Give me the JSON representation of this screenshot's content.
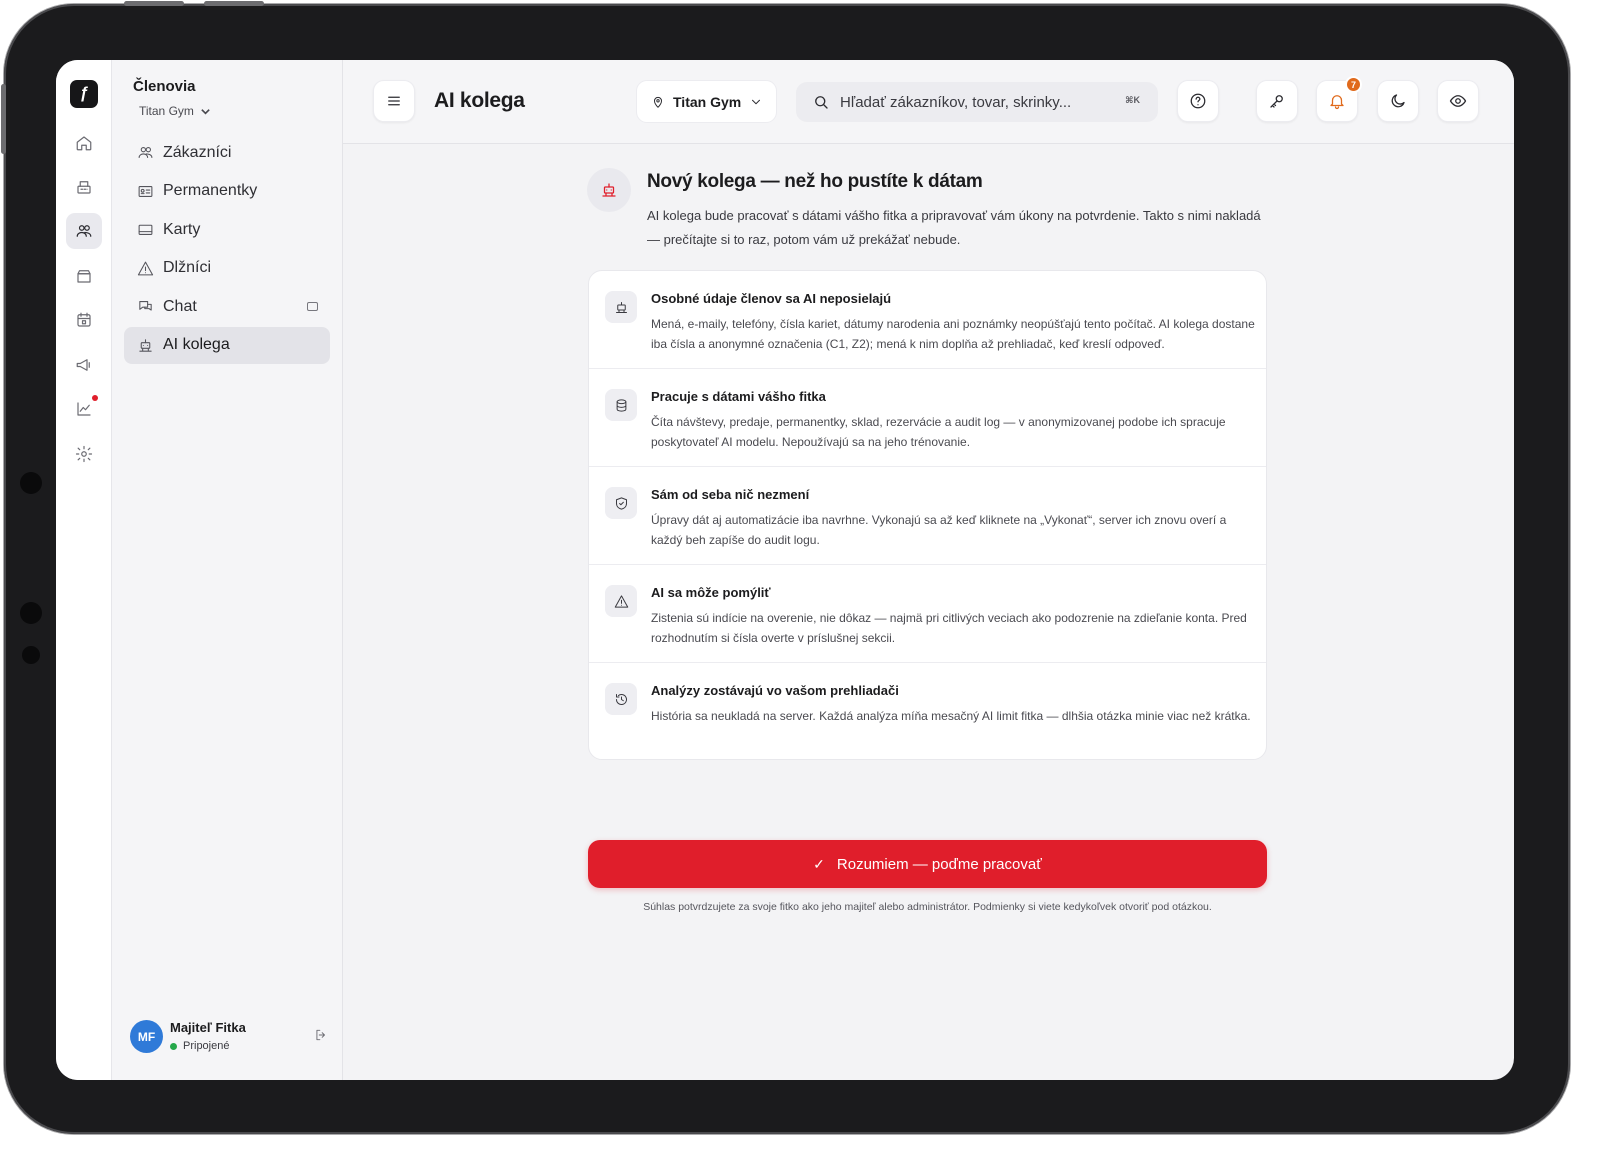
{
  "sidebar": {
    "title": "Členovia",
    "gym": "Titan Gym",
    "items": [
      {
        "label": "Zákazníci",
        "icon": "users-icon"
      },
      {
        "label": "Permanentky",
        "icon": "id-card-icon"
      },
      {
        "label": "Karty",
        "icon": "card-icon"
      },
      {
        "label": "Dlžníci",
        "icon": "warning-icon"
      },
      {
        "label": "Chat",
        "icon": "chat-icon"
      },
      {
        "label": "AI kolega",
        "icon": "robot-icon",
        "active": true
      }
    ],
    "user": {
      "initials": "MF",
      "name": "Majiteľ Fitka",
      "status": "Pripojené"
    }
  },
  "rail": {
    "items": [
      "home-icon",
      "register-icon",
      "members-icon",
      "store-icon",
      "calendar-icon",
      "megaphone-icon",
      "chart-icon",
      "settings-icon"
    ],
    "active": "members-icon"
  },
  "header": {
    "title": "AI kolega",
    "location": "Titan Gym",
    "search_placeholder": "Hľadať zákazníkov, tovar, skrinky...",
    "search_shortcut": "⌘K",
    "notifications_count": "7"
  },
  "intro": {
    "title": "Nový kolega — než ho pustíte k dátam",
    "text": "AI kolega bude pracovať s dátami vášho fitka a pripravovať vám úkony na potvrdenie. Takto s nimi nakladá — prečítajte si to raz, potom vám už prekážať nebude."
  },
  "cards": [
    {
      "title": "Osobné údaje členov sa AI neposielajú",
      "text": "Mená, e-maily, telefóny, čísla kariet, dátumy narodenia ani poznámky neopúšťajú tento počítač. AI kolega dostane iba čísla a anonymné označenia (C1, Z2); mená k nim doplňa až prehliadač, keď kreslí odpoveď.",
      "icon": "robot-icon"
    },
    {
      "title": "Pracuje s dátami vášho fitka",
      "text": "Číta návštevy, predaje, permanentky, sklad, rezervácie a audit log — v anonymizovanej podobe ich spracuje poskytovateľ AI modelu. Nepoužívajú sa na jeho trénovanie.",
      "icon": "database-icon"
    },
    {
      "title": "Sám od seba nič nezmení",
      "text": "Úpravy dát aj automatizácie iba navrhne. Vykonajú sa až keď kliknete na „Vykonať“, server ich znovu overí a každý beh zapíše do audit logu.",
      "icon": "shield-check-icon"
    },
    {
      "title": "AI sa môže pomýliť",
      "text": "Zistenia sú indície na overenie, nie dôkaz — najmä pri citlivých veciach ako podozrenie na zdieľanie konta. Pred rozhodnutím si čísla overte v príslušnej sekcii.",
      "icon": "warning-icon"
    },
    {
      "title": "Analýzy zostávajú vo vašom prehliadači",
      "text": "História sa neukladá na server. Každá analýza míňa mesačný AI limit fitka — dlhšia otázka minie viac než krátka.",
      "icon": "history-icon"
    }
  ],
  "cta": {
    "label": "Rozumiem — poďme pracovať",
    "icon": "check-icon"
  },
  "consent": "Súhlas potvrdzujete za svoje fitko ako jeho majiteľ alebo administrátor. Podmienky si viete kedykoľvek otvoriť pod otázkou.",
  "colors": {
    "accent": "#e01e2b",
    "avatar": "#2f7ad8",
    "online": "#25a84a",
    "notification": "#e06a1c"
  }
}
